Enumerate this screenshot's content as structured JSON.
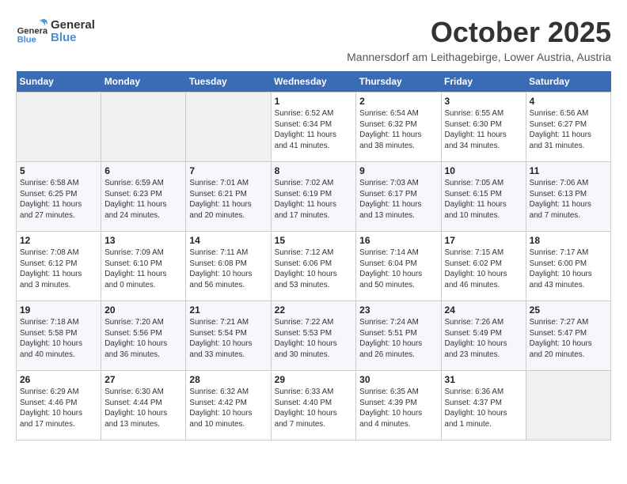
{
  "header": {
    "logo_general": "General",
    "logo_blue": "Blue",
    "month": "October 2025",
    "location": "Mannersdorf am Leithagebirge, Lower Austria, Austria"
  },
  "weekdays": [
    "Sunday",
    "Monday",
    "Tuesday",
    "Wednesday",
    "Thursday",
    "Friday",
    "Saturday"
  ],
  "weeks": [
    [
      {
        "day": "",
        "info": ""
      },
      {
        "day": "",
        "info": ""
      },
      {
        "day": "",
        "info": ""
      },
      {
        "day": "1",
        "info": "Sunrise: 6:52 AM\nSunset: 6:34 PM\nDaylight: 11 hours\nand 41 minutes."
      },
      {
        "day": "2",
        "info": "Sunrise: 6:54 AM\nSunset: 6:32 PM\nDaylight: 11 hours\nand 38 minutes."
      },
      {
        "day": "3",
        "info": "Sunrise: 6:55 AM\nSunset: 6:30 PM\nDaylight: 11 hours\nand 34 minutes."
      },
      {
        "day": "4",
        "info": "Sunrise: 6:56 AM\nSunset: 6:27 PM\nDaylight: 11 hours\nand 31 minutes."
      }
    ],
    [
      {
        "day": "5",
        "info": "Sunrise: 6:58 AM\nSunset: 6:25 PM\nDaylight: 11 hours\nand 27 minutes."
      },
      {
        "day": "6",
        "info": "Sunrise: 6:59 AM\nSunset: 6:23 PM\nDaylight: 11 hours\nand 24 minutes."
      },
      {
        "day": "7",
        "info": "Sunrise: 7:01 AM\nSunset: 6:21 PM\nDaylight: 11 hours\nand 20 minutes."
      },
      {
        "day": "8",
        "info": "Sunrise: 7:02 AM\nSunset: 6:19 PM\nDaylight: 11 hours\nand 17 minutes."
      },
      {
        "day": "9",
        "info": "Sunrise: 7:03 AM\nSunset: 6:17 PM\nDaylight: 11 hours\nand 13 minutes."
      },
      {
        "day": "10",
        "info": "Sunrise: 7:05 AM\nSunset: 6:15 PM\nDaylight: 11 hours\nand 10 minutes."
      },
      {
        "day": "11",
        "info": "Sunrise: 7:06 AM\nSunset: 6:13 PM\nDaylight: 11 hours\nand 7 minutes."
      }
    ],
    [
      {
        "day": "12",
        "info": "Sunrise: 7:08 AM\nSunset: 6:12 PM\nDaylight: 11 hours\nand 3 minutes."
      },
      {
        "day": "13",
        "info": "Sunrise: 7:09 AM\nSunset: 6:10 PM\nDaylight: 11 hours\nand 0 minutes."
      },
      {
        "day": "14",
        "info": "Sunrise: 7:11 AM\nSunset: 6:08 PM\nDaylight: 10 hours\nand 56 minutes."
      },
      {
        "day": "15",
        "info": "Sunrise: 7:12 AM\nSunset: 6:06 PM\nDaylight: 10 hours\nand 53 minutes."
      },
      {
        "day": "16",
        "info": "Sunrise: 7:14 AM\nSunset: 6:04 PM\nDaylight: 10 hours\nand 50 minutes."
      },
      {
        "day": "17",
        "info": "Sunrise: 7:15 AM\nSunset: 6:02 PM\nDaylight: 10 hours\nand 46 minutes."
      },
      {
        "day": "18",
        "info": "Sunrise: 7:17 AM\nSunset: 6:00 PM\nDaylight: 10 hours\nand 43 minutes."
      }
    ],
    [
      {
        "day": "19",
        "info": "Sunrise: 7:18 AM\nSunset: 5:58 PM\nDaylight: 10 hours\nand 40 minutes."
      },
      {
        "day": "20",
        "info": "Sunrise: 7:20 AM\nSunset: 5:56 PM\nDaylight: 10 hours\nand 36 minutes."
      },
      {
        "day": "21",
        "info": "Sunrise: 7:21 AM\nSunset: 5:54 PM\nDaylight: 10 hours\nand 33 minutes."
      },
      {
        "day": "22",
        "info": "Sunrise: 7:22 AM\nSunset: 5:53 PM\nDaylight: 10 hours\nand 30 minutes."
      },
      {
        "day": "23",
        "info": "Sunrise: 7:24 AM\nSunset: 5:51 PM\nDaylight: 10 hours\nand 26 minutes."
      },
      {
        "day": "24",
        "info": "Sunrise: 7:26 AM\nSunset: 5:49 PM\nDaylight: 10 hours\nand 23 minutes."
      },
      {
        "day": "25",
        "info": "Sunrise: 7:27 AM\nSunset: 5:47 PM\nDaylight: 10 hours\nand 20 minutes."
      }
    ],
    [
      {
        "day": "26",
        "info": "Sunrise: 6:29 AM\nSunset: 4:46 PM\nDaylight: 10 hours\nand 17 minutes."
      },
      {
        "day": "27",
        "info": "Sunrise: 6:30 AM\nSunset: 4:44 PM\nDaylight: 10 hours\nand 13 minutes."
      },
      {
        "day": "28",
        "info": "Sunrise: 6:32 AM\nSunset: 4:42 PM\nDaylight: 10 hours\nand 10 minutes."
      },
      {
        "day": "29",
        "info": "Sunrise: 6:33 AM\nSunset: 4:40 PM\nDaylight: 10 hours\nand 7 minutes."
      },
      {
        "day": "30",
        "info": "Sunrise: 6:35 AM\nSunset: 4:39 PM\nDaylight: 10 hours\nand 4 minutes."
      },
      {
        "day": "31",
        "info": "Sunrise: 6:36 AM\nSunset: 4:37 PM\nDaylight: 10 hours\nand 1 minute."
      },
      {
        "day": "",
        "info": ""
      }
    ]
  ]
}
